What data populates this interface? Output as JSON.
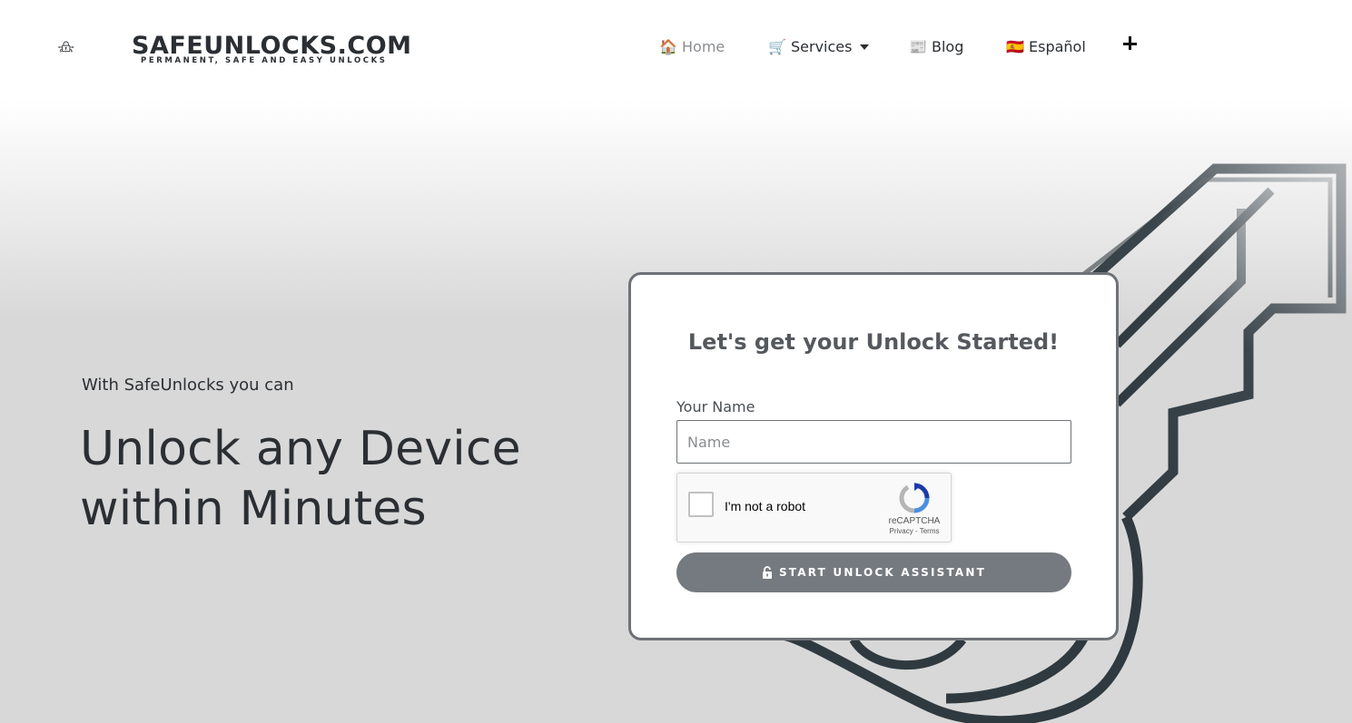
{
  "logo": {
    "name": "SAFEUNLOCKS.COM",
    "tagline": "PERMANENT, SAFE AND EASY UNLOCKS"
  },
  "nav": {
    "items": [
      {
        "emoji": "🏠",
        "label": "Home",
        "active": true
      },
      {
        "emoji": "🛒",
        "label": "Services",
        "has_dropdown": true
      },
      {
        "emoji": "📰",
        "label": "Blog"
      },
      {
        "emoji": "🇪🇸",
        "label": "Español"
      }
    ],
    "more_icon": "plus-icon"
  },
  "hero": {
    "subtitle": "With SafeUnlocks you can",
    "title_line1": "Unlock any Device",
    "title_line2": "within Minutes"
  },
  "form": {
    "title": "Let's get your Unlock Started!",
    "name_label": "Your Name",
    "name_placeholder": "Name",
    "name_value": "",
    "recaptcha": {
      "label": "I'm not a robot",
      "brand": "reCAPTCHA",
      "privacy": "Privacy",
      "separator": " - ",
      "terms": "Terms"
    },
    "submit_label": "START UNLOCK ASSISTANT",
    "submit_icon": "unlock-icon"
  },
  "colors": {
    "text_dark": "#2b2f33",
    "nav_active": "#8a8d90",
    "button_bg": "#757a80",
    "card_border": "#6e7277",
    "key_dark": "#2f3a40",
    "background": "#d8d8d8"
  }
}
